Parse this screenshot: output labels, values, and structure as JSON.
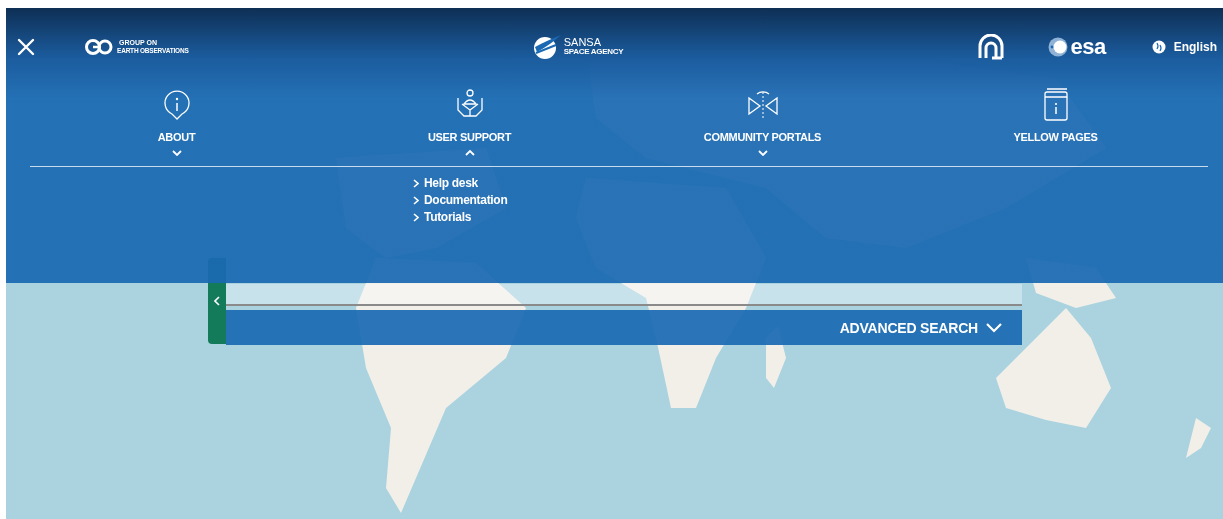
{
  "top_bar": {
    "geo_logo": {
      "line_1": "GROUP ON",
      "line_2": "EARTH OBSERVATIONS"
    },
    "sansa_logo": {
      "name": "SANSA",
      "subtitle": "SPACE AGENCY"
    },
    "esa_logo": {
      "name": "esa"
    },
    "language": "English"
  },
  "nav": [
    {
      "kind": "info",
      "label": "ABOUT",
      "expanded": false
    },
    {
      "kind": "support",
      "label": "USER SUPPORT",
      "expanded": true,
      "children": [
        {
          "label": "Help desk"
        },
        {
          "label": "Documentation"
        },
        {
          "label": "Tutorials"
        }
      ]
    },
    {
      "kind": "portals",
      "label": "COMMUNITY PORTALS",
      "expanded": false
    },
    {
      "kind": "book",
      "label": "YELLOW PAGES"
    }
  ],
  "search": {
    "advanced_label": "ADVANCED SEARCH"
  }
}
